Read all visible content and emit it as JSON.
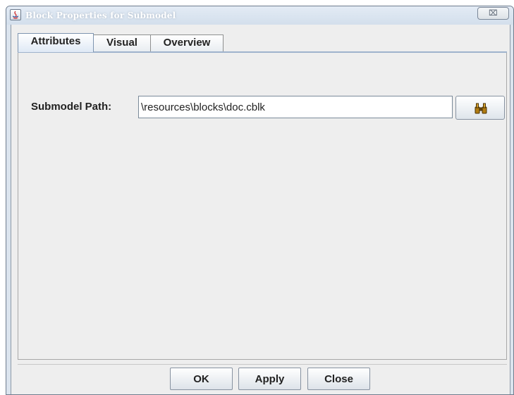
{
  "window": {
    "title": "Block Properties for Submodel",
    "close_glyph": "⌧"
  },
  "tabs": [
    {
      "label": "Attributes",
      "active": true
    },
    {
      "label": "Visual",
      "active": false
    },
    {
      "label": "Overview",
      "active": false
    }
  ],
  "attributes": {
    "submodel_path_label": "Submodel Path:",
    "submodel_path_value": "\\resources\\blocks\\doc.cblk",
    "browse_icon": "binoculars-icon"
  },
  "buttons": {
    "ok": "OK",
    "apply": "Apply",
    "close": "Close"
  },
  "colors": {
    "title_bar": "#dbe4ee",
    "panel_background": "#eeeeee",
    "tab_highlight": "#dfe9f5"
  }
}
